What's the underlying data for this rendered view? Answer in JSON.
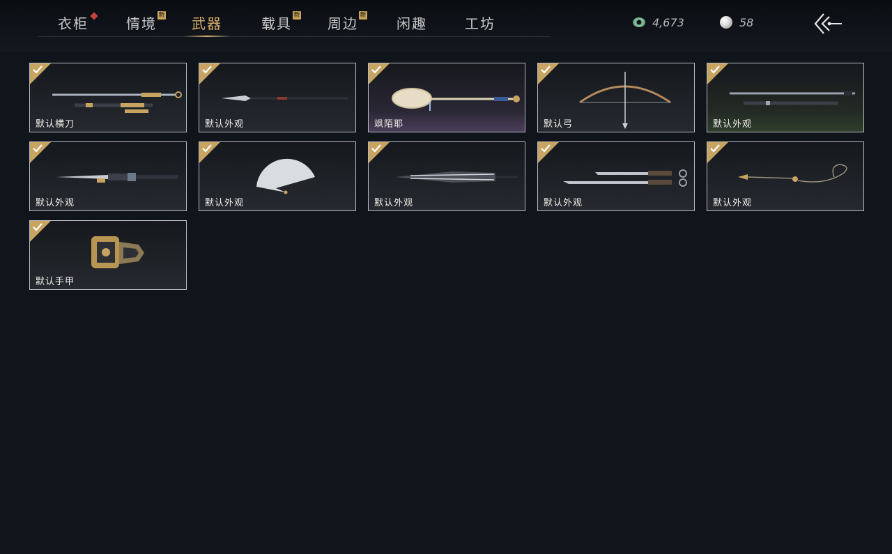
{
  "tabs": [
    {
      "label": "衣柜",
      "badge": "dot"
    },
    {
      "label": "情境",
      "badge": "新"
    },
    {
      "label": "武器",
      "badge": "",
      "active": true
    },
    {
      "label": "载具",
      "badge": "新"
    },
    {
      "label": "周边",
      "badge": "新"
    },
    {
      "label": "闲趣",
      "badge": ""
    },
    {
      "label": "工坊",
      "badge": ""
    }
  ],
  "currency": {
    "jade": {
      "value": "4,673",
      "icon": "jade-coin-icon"
    },
    "pearl": {
      "value": "58",
      "icon": "pearl-icon"
    }
  },
  "back_icon": "back-arrow-icon",
  "items": [
    {
      "label": "默认横刀",
      "art": "saber"
    },
    {
      "label": "默认外观",
      "art": "spear"
    },
    {
      "label": "飒陌耶",
      "art": "racket"
    },
    {
      "label": "默认弓",
      "art": "bow"
    },
    {
      "label": "默认外观",
      "art": "twin-swords"
    },
    {
      "label": "默认外观",
      "art": "sword"
    },
    {
      "label": "默认外观",
      "art": "fan"
    },
    {
      "label": "默认外观",
      "art": "umbrella"
    },
    {
      "label": "默认外观",
      "art": "dual-blades"
    },
    {
      "label": "默认外观",
      "art": "rope-dart"
    },
    {
      "label": "默认手甲",
      "art": "gauntlet"
    }
  ],
  "colors": {
    "accent": "#d8b06a",
    "check_badge": "#c7a462",
    "new_badge": "#c9a45a",
    "alert_dot": "#c2433b"
  }
}
